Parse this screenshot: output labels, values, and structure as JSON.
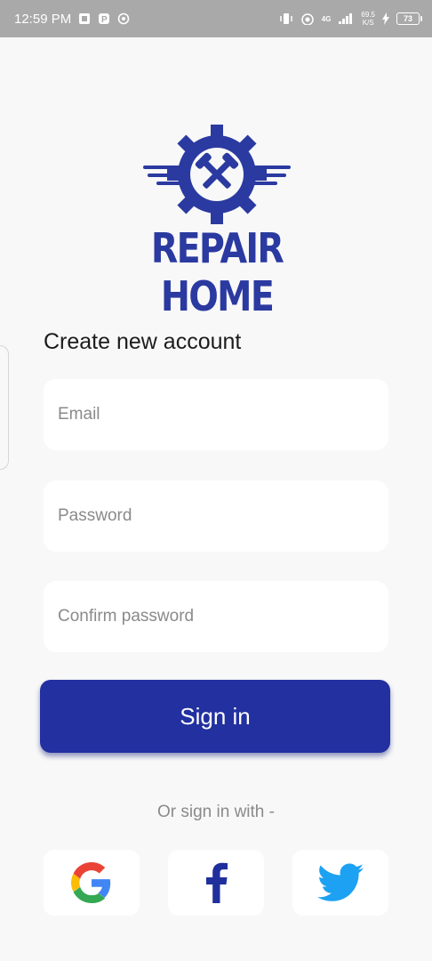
{
  "status_bar": {
    "time": "12:59 PM",
    "net_speed_value": "69.5",
    "net_speed_unit": "K/S",
    "network_type": "4G",
    "battery": "73"
  },
  "logo": {
    "brand": "REPAIR HOME",
    "icon": "gear-wrench-logo-icon",
    "color": "#2b3aa0"
  },
  "form": {
    "title": "Create new account",
    "email_placeholder": "Email",
    "password_placeholder": "Password",
    "confirm_placeholder": "Confirm password",
    "submit_label": "Sign in"
  },
  "social": {
    "label": "Or sign in with -",
    "providers": [
      {
        "name": "Google",
        "icon": "google-icon"
      },
      {
        "name": "Facebook",
        "icon": "facebook-icon"
      },
      {
        "name": "Twitter",
        "icon": "twitter-icon"
      }
    ]
  },
  "colors": {
    "primary": "#2230a0",
    "background": "#f8f8f8",
    "status_bar": "#a9a9a9",
    "facebook": "#1f2f9c",
    "twitter": "#1da1f2"
  }
}
